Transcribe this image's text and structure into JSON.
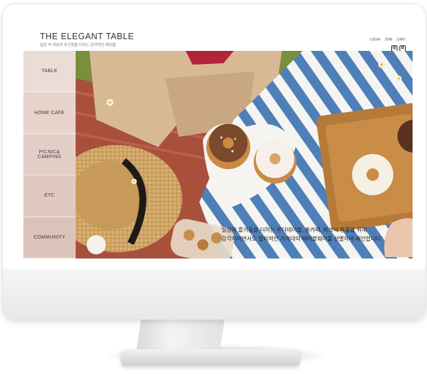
{
  "site": {
    "title": "THE ELEGANT TABLE",
    "subtitle": "일상 속 여유와 포근함을 더하는 감각적인 테이블"
  },
  "top_links": [
    "LOGIN",
    "JOIN",
    "CART"
  ],
  "social": [
    {
      "icon": "instagram-icon",
      "glyph": "◎"
    },
    {
      "icon": "blog-icon",
      "glyph": "B"
    }
  ],
  "sidebar": {
    "items": [
      {
        "label": "TABLE",
        "color": "#ecdcd6"
      },
      {
        "label": "HOME CAFE",
        "color": "#e7d3cc"
      },
      {
        "label": "PICNIC&\nCAMPING",
        "color": "#e4cfc8"
      },
      {
        "label": "ETC",
        "color": "#e0c9c1"
      },
      {
        "label": "COMMUNITY",
        "color": "#dcc3ba"
      }
    ]
  },
  "hero": {
    "caption_line1": "일상의 즐거움을 더하는 온더테이블, 홈카페, 피크닉 용품을 위해",
    "caption_line2": "감각적이면서도 합리적인 가격대의 테이블웨어를 선별하여 제안합니다"
  }
}
